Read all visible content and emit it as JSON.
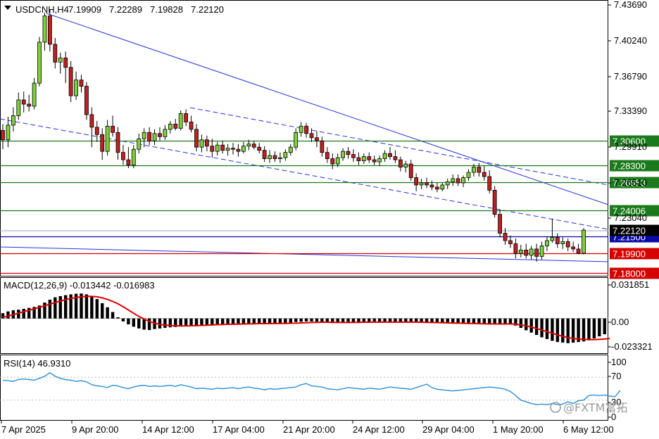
{
  "chart_data": {
    "type": "candlestick",
    "symbol": "USDCNH,H4",
    "ohlc": {
      "open": "7.19909",
      "high": "7.22289",
      "low": "7.19828",
      "close": "7.22120"
    },
    "price_axis": {
      "ylim": [
        7.1775,
        7.4395
      ],
      "ticks": [
        "7.43690",
        "7.40240",
        "7.36790",
        "7.33390",
        "7.29910",
        "7.26510",
        "7.23040"
      ]
    },
    "date_labels": [
      "7 Apr 2025",
      "9 Apr 20:00",
      "14 Apr 12:00",
      "17 Apr 04:00",
      "21 Apr 20:00",
      "24 Apr 12:00",
      "29 Apr 04:00",
      "1 May 20:00",
      "6 May 12:00"
    ],
    "candles": [
      {
        "o": 7.316,
        "h": 7.322,
        "l": 7.298,
        "c": 7.307
      },
      {
        "o": 7.307,
        "h": 7.329,
        "l": 7.3,
        "c": 7.321
      },
      {
        "o": 7.321,
        "h": 7.338,
        "l": 7.315,
        "c": 7.33
      },
      {
        "o": 7.33,
        "h": 7.352,
        "l": 7.326,
        "c": 7.345
      },
      {
        "o": 7.345,
        "h": 7.353,
        "l": 7.333,
        "c": 7.341
      },
      {
        "o": 7.341,
        "h": 7.35,
        "l": 7.334,
        "c": 7.339
      },
      {
        "o": 7.339,
        "h": 7.366,
        "l": 7.336,
        "c": 7.361
      },
      {
        "o": 7.361,
        "h": 7.405,
        "l": 7.358,
        "c": 7.4
      },
      {
        "o": 7.4,
        "h": 7.428,
        "l": 7.392,
        "c": 7.425
      },
      {
        "o": 7.425,
        "h": 7.431,
        "l": 7.391,
        "c": 7.398
      },
      {
        "o": 7.398,
        "h": 7.404,
        "l": 7.375,
        "c": 7.381
      },
      {
        "o": 7.381,
        "h": 7.39,
        "l": 7.37,
        "c": 7.385
      },
      {
        "o": 7.385,
        "h": 7.391,
        "l": 7.361,
        "c": 7.376
      },
      {
        "o": 7.376,
        "h": 7.382,
        "l": 7.343,
        "c": 7.349
      },
      {
        "o": 7.349,
        "h": 7.372,
        "l": 7.345,
        "c": 7.364
      },
      {
        "o": 7.364,
        "h": 7.369,
        "l": 7.352,
        "c": 7.358
      },
      {
        "o": 7.358,
        "h": 7.362,
        "l": 7.326,
        "c": 7.331
      },
      {
        "o": 7.331,
        "h": 7.338,
        "l": 7.3,
        "c": 7.319
      },
      {
        "o": 7.319,
        "h": 7.325,
        "l": 7.305,
        "c": 7.312
      },
      {
        "o": 7.312,
        "h": 7.318,
        "l": 7.288,
        "c": 7.296
      },
      {
        "o": 7.296,
        "h": 7.326,
        "l": 7.292,
        "c": 7.32
      },
      {
        "o": 7.32,
        "h": 7.33,
        "l": 7.31,
        "c": 7.314
      },
      {
        "o": 7.314,
        "h": 7.319,
        "l": 7.288,
        "c": 7.295
      },
      {
        "o": 7.295,
        "h": 7.302,
        "l": 7.283,
        "c": 7.288
      },
      {
        "o": 7.288,
        "h": 7.3,
        "l": 7.28,
        "c": 7.283
      },
      {
        "o": 7.283,
        "h": 7.302,
        "l": 7.28,
        "c": 7.298
      },
      {
        "o": 7.298,
        "h": 7.313,
        "l": 7.294,
        "c": 7.308
      },
      {
        "o": 7.308,
        "h": 7.318,
        "l": 7.3,
        "c": 7.314
      },
      {
        "o": 7.314,
        "h": 7.319,
        "l": 7.302,
        "c": 7.306
      },
      {
        "o": 7.306,
        "h": 7.317,
        "l": 7.302,
        "c": 7.313
      },
      {
        "o": 7.313,
        "h": 7.319,
        "l": 7.306,
        "c": 7.31
      },
      {
        "o": 7.31,
        "h": 7.321,
        "l": 7.307,
        "c": 7.317
      },
      {
        "o": 7.317,
        "h": 7.325,
        "l": 7.313,
        "c": 7.322
      },
      {
        "o": 7.322,
        "h": 7.327,
        "l": 7.316,
        "c": 7.318
      },
      {
        "o": 7.318,
        "h": 7.335,
        "l": 7.316,
        "c": 7.332
      },
      {
        "o": 7.332,
        "h": 7.336,
        "l": 7.32,
        "c": 7.324
      },
      {
        "o": 7.324,
        "h": 7.33,
        "l": 7.314,
        "c": 7.317
      },
      {
        "o": 7.317,
        "h": 7.322,
        "l": 7.296,
        "c": 7.3
      },
      {
        "o": 7.3,
        "h": 7.312,
        "l": 7.295,
        "c": 7.307
      },
      {
        "o": 7.307,
        "h": 7.311,
        "l": 7.296,
        "c": 7.301
      },
      {
        "o": 7.301,
        "h": 7.308,
        "l": 7.29,
        "c": 7.296
      },
      {
        "o": 7.296,
        "h": 7.305,
        "l": 7.292,
        "c": 7.302
      },
      {
        "o": 7.302,
        "h": 7.306,
        "l": 7.294,
        "c": 7.297
      },
      {
        "o": 7.297,
        "h": 7.303,
        "l": 7.292,
        "c": 7.299
      },
      {
        "o": 7.299,
        "h": 7.304,
        "l": 7.293,
        "c": 7.298
      },
      {
        "o": 7.298,
        "h": 7.303,
        "l": 7.291,
        "c": 7.296
      },
      {
        "o": 7.296,
        "h": 7.305,
        "l": 7.294,
        "c": 7.301
      },
      {
        "o": 7.301,
        "h": 7.307,
        "l": 7.297,
        "c": 7.303
      },
      {
        "o": 7.303,
        "h": 7.306,
        "l": 7.298,
        "c": 7.3
      },
      {
        "o": 7.3,
        "h": 7.304,
        "l": 7.294,
        "c": 7.297
      },
      {
        "o": 7.297,
        "h": 7.301,
        "l": 7.286,
        "c": 7.289
      },
      {
        "o": 7.289,
        "h": 7.297,
        "l": 7.285,
        "c": 7.292
      },
      {
        "o": 7.292,
        "h": 7.296,
        "l": 7.286,
        "c": 7.289
      },
      {
        "o": 7.289,
        "h": 7.295,
        "l": 7.285,
        "c": 7.29
      },
      {
        "o": 7.29,
        "h": 7.298,
        "l": 7.287,
        "c": 7.295
      },
      {
        "o": 7.295,
        "h": 7.303,
        "l": 7.292,
        "c": 7.3
      },
      {
        "o": 7.3,
        "h": 7.318,
        "l": 7.297,
        "c": 7.314
      },
      {
        "o": 7.314,
        "h": 7.324,
        "l": 7.31,
        "c": 7.32
      },
      {
        "o": 7.32,
        "h": 7.323,
        "l": 7.309,
        "c": 7.313
      },
      {
        "o": 7.313,
        "h": 7.318,
        "l": 7.305,
        "c": 7.309
      },
      {
        "o": 7.309,
        "h": 7.315,
        "l": 7.3,
        "c": 7.306
      },
      {
        "o": 7.306,
        "h": 7.31,
        "l": 7.291,
        "c": 7.295
      },
      {
        "o": 7.295,
        "h": 7.3,
        "l": 7.285,
        "c": 7.289
      },
      {
        "o": 7.289,
        "h": 7.294,
        "l": 7.279,
        "c": 7.284
      },
      {
        "o": 7.284,
        "h": 7.294,
        "l": 7.281,
        "c": 7.29
      },
      {
        "o": 7.29,
        "h": 7.299,
        "l": 7.287,
        "c": 7.296
      },
      {
        "o": 7.296,
        "h": 7.3,
        "l": 7.289,
        "c": 7.293
      },
      {
        "o": 7.293,
        "h": 7.298,
        "l": 7.286,
        "c": 7.29
      },
      {
        "o": 7.29,
        "h": 7.295,
        "l": 7.283,
        "c": 7.287
      },
      {
        "o": 7.287,
        "h": 7.294,
        "l": 7.284,
        "c": 7.291
      },
      {
        "o": 7.291,
        "h": 7.295,
        "l": 7.285,
        "c": 7.288
      },
      {
        "o": 7.288,
        "h": 7.292,
        "l": 7.283,
        "c": 7.286
      },
      {
        "o": 7.286,
        "h": 7.292,
        "l": 7.282,
        "c": 7.289
      },
      {
        "o": 7.289,
        "h": 7.297,
        "l": 7.286,
        "c": 7.294
      },
      {
        "o": 7.294,
        "h": 7.3,
        "l": 7.288,
        "c": 7.291
      },
      {
        "o": 7.291,
        "h": 7.297,
        "l": 7.285,
        "c": 7.288
      },
      {
        "o": 7.288,
        "h": 7.291,
        "l": 7.277,
        "c": 7.281
      },
      {
        "o": 7.281,
        "h": 7.287,
        "l": 7.276,
        "c": 7.284
      },
      {
        "o": 7.284,
        "h": 7.288,
        "l": 7.268,
        "c": 7.271
      },
      {
        "o": 7.271,
        "h": 7.275,
        "l": 7.258,
        "c": 7.264
      },
      {
        "o": 7.264,
        "h": 7.27,
        "l": 7.26,
        "c": 7.266
      },
      {
        "o": 7.266,
        "h": 7.271,
        "l": 7.261,
        "c": 7.264
      },
      {
        "o": 7.264,
        "h": 7.268,
        "l": 7.259,
        "c": 7.262
      },
      {
        "o": 7.262,
        "h": 7.266,
        "l": 7.257,
        "c": 7.26
      },
      {
        "o": 7.26,
        "h": 7.266,
        "l": 7.258,
        "c": 7.264
      },
      {
        "o": 7.264,
        "h": 7.27,
        "l": 7.26,
        "c": 7.267
      },
      {
        "o": 7.267,
        "h": 7.274,
        "l": 7.263,
        "c": 7.27
      },
      {
        "o": 7.27,
        "h": 7.274,
        "l": 7.263,
        "c": 7.266
      },
      {
        "o": 7.266,
        "h": 7.273,
        "l": 7.262,
        "c": 7.271
      },
      {
        "o": 7.271,
        "h": 7.279,
        "l": 7.268,
        "c": 7.276
      },
      {
        "o": 7.276,
        "h": 7.284,
        "l": 7.272,
        "c": 7.281
      },
      {
        "o": 7.281,
        "h": 7.285,
        "l": 7.272,
        "c": 7.276
      },
      {
        "o": 7.276,
        "h": 7.282,
        "l": 7.268,
        "c": 7.272
      },
      {
        "o": 7.272,
        "h": 7.278,
        "l": 7.256,
        "c": 7.259
      },
      {
        "o": 7.259,
        "h": 7.263,
        "l": 7.233,
        "c": 7.236
      },
      {
        "o": 7.236,
        "h": 7.241,
        "l": 7.214,
        "c": 7.218
      },
      {
        "o": 7.218,
        "h": 7.223,
        "l": 7.207,
        "c": 7.211
      },
      {
        "o": 7.211,
        "h": 7.216,
        "l": 7.204,
        "c": 7.208
      },
      {
        "o": 7.208,
        "h": 7.213,
        "l": 7.194,
        "c": 7.199
      },
      {
        "o": 7.199,
        "h": 7.207,
        "l": 7.195,
        "c": 7.202
      },
      {
        "o": 7.202,
        "h": 7.208,
        "l": 7.194,
        "c": 7.197
      },
      {
        "o": 7.197,
        "h": 7.206,
        "l": 7.193,
        "c": 7.203
      },
      {
        "o": 7.203,
        "h": 7.208,
        "l": 7.191,
        "c": 7.196
      },
      {
        "o": 7.196,
        "h": 7.21,
        "l": 7.193,
        "c": 7.206
      },
      {
        "o": 7.206,
        "h": 7.215,
        "l": 7.201,
        "c": 7.211
      },
      {
        "o": 7.211,
        "h": 7.232,
        "l": 7.209,
        "c": 7.214
      },
      {
        "o": 7.214,
        "h": 7.218,
        "l": 7.204,
        "c": 7.208
      },
      {
        "o": 7.208,
        "h": 7.214,
        "l": 7.203,
        "c": 7.21
      },
      {
        "o": 7.21,
        "h": 7.213,
        "l": 7.201,
        "c": 7.205
      },
      {
        "o": 7.205,
        "h": 7.21,
        "l": 7.2,
        "c": 7.203
      },
      {
        "o": 7.203,
        "h": 7.208,
        "l": 7.198,
        "c": 7.199
      },
      {
        "o": 7.199,
        "h": 7.223,
        "l": 7.198,
        "c": 7.221
      }
    ],
    "horizontal_lines": [
      {
        "label": "7.30600",
        "value": 7.306,
        "color": "#1b7a1b"
      },
      {
        "label": "7.28300",
        "value": 7.283,
        "color": "#1b7a1b"
      },
      {
        "label": "7.26653",
        "value": 7.26653,
        "color": "#1b7a1b"
      },
      {
        "label": "7.24006",
        "value": 7.24006,
        "color": "#1b7a1b"
      },
      {
        "label": "7.21500",
        "value": 7.215,
        "color": "#0a0aa8"
      },
      {
        "label": "7.19900",
        "value": 7.199,
        "color": "#d50000"
      },
      {
        "label": "7.18000",
        "value": 7.18,
        "color": "#d50000"
      }
    ],
    "current_price": {
      "label": "7.22120",
      "value": 7.2212
    },
    "macd": {
      "label": "MACD(12,26,9) -0.013442 -0.016983",
      "ylim": [
        -0.0295,
        0.0345
      ],
      "ticks": [
        "0.031851",
        "0.00",
        "-0.023321"
      ],
      "histogram": [
        0.0045,
        0.006,
        0.007,
        0.0075,
        0.0082,
        0.009,
        0.0098,
        0.011,
        0.0135,
        0.016,
        0.018,
        0.019,
        0.0198,
        0.0205,
        0.021,
        0.0212,
        0.0205,
        0.019,
        0.0165,
        0.013,
        0.0095,
        0.0055,
        0.001,
        -0.0025,
        -0.005,
        -0.007,
        -0.0085,
        -0.0095,
        -0.0098,
        -0.009,
        -0.0085,
        -0.008,
        -0.0075,
        -0.0072,
        -0.0068,
        -0.0065,
        -0.006,
        -0.0058,
        -0.0055,
        -0.0052,
        -0.005,
        -0.0048,
        -0.0047,
        -0.0046,
        -0.0045,
        -0.0045,
        -0.0044,
        -0.0044,
        -0.0043,
        -0.0043,
        -0.0042,
        -0.0042,
        -0.0041,
        -0.004,
        -0.0038,
        -0.0035,
        -0.003,
        -0.0028,
        -0.0025,
        -0.0025,
        -0.0027,
        -0.003,
        -0.0032,
        -0.0034,
        -0.0035,
        -0.0034,
        -0.0033,
        -0.0032,
        -0.0031,
        -0.003,
        -0.003,
        -0.0029,
        -0.0029,
        -0.003,
        -0.003,
        -0.0031,
        -0.0031,
        -0.003,
        -0.0031,
        -0.0032,
        -0.0034,
        -0.0036,
        -0.0038,
        -0.004,
        -0.0041,
        -0.0042,
        -0.0043,
        -0.0044,
        -0.0045,
        -0.0046,
        -0.0047,
        -0.0049,
        -0.005,
        -0.0051,
        -0.005,
        -0.0048,
        -0.0045,
        -0.0045,
        -0.006,
        -0.008,
        -0.01,
        -0.012,
        -0.014,
        -0.016,
        -0.0175,
        -0.019,
        -0.02,
        -0.0205,
        -0.021,
        -0.0205,
        -0.02,
        -0.0195,
        -0.0185,
        -0.017,
        -0.0152,
        -0.0134
      ],
      "signal": [
        0.001,
        0.002,
        0.0032,
        0.0045,
        0.0058,
        0.007,
        0.0082,
        0.0095,
        0.0108,
        0.0122,
        0.0136,
        0.0148,
        0.016,
        0.017,
        0.0178,
        0.0184,
        0.0188,
        0.0188,
        0.0184,
        0.0175,
        0.0162,
        0.0145,
        0.0125,
        0.01,
        0.0072,
        0.0044,
        0.0018,
        -0.0005,
        -0.0025,
        -0.004,
        -0.005,
        -0.0056,
        -0.006,
        -0.0062,
        -0.0063,
        -0.0063,
        -0.0062,
        -0.0061,
        -0.0059,
        -0.0057,
        -0.0055,
        -0.0053,
        -0.0051,
        -0.005,
        -0.0049,
        -0.0048,
        -0.0047,
        -0.0046,
        -0.0045,
        -0.0044,
        -0.0044,
        -0.0043,
        -0.0043,
        -0.0042,
        -0.0042,
        -0.0041,
        -0.004,
        -0.0038,
        -0.0036,
        -0.0034,
        -0.0033,
        -0.0032,
        -0.0032,
        -0.0033,
        -0.0034,
        -0.0034,
        -0.0034,
        -0.0033,
        -0.0033,
        -0.0032,
        -0.0032,
        -0.0031,
        -0.0031,
        -0.0031,
        -0.0031,
        -0.0031,
        -0.0031,
        -0.0031,
        -0.0031,
        -0.0031,
        -0.0032,
        -0.0033,
        -0.0034,
        -0.0035,
        -0.0036,
        -0.0037,
        -0.0039,
        -0.004,
        -0.0041,
        -0.0042,
        -0.0043,
        -0.0044,
        -0.0045,
        -0.0046,
        -0.0047,
        -0.0047,
        -0.0047,
        -0.0046,
        -0.0049,
        -0.0055,
        -0.0063,
        -0.0073,
        -0.0085,
        -0.0098,
        -0.0112,
        -0.0126,
        -0.014,
        -0.0152,
        -0.0162,
        -0.017,
        -0.0175,
        -0.0178,
        -0.018,
        -0.018,
        -0.0178,
        -0.0175,
        -0.017
      ]
    },
    "rsi": {
      "label": "RSI(14) 46.9310",
      "ylim": [
        0,
        100
      ],
      "ticks": [
        "100",
        "70",
        "30",
        "0"
      ],
      "levels": [
        70,
        30
      ],
      "values": [
        65,
        64,
        63,
        66,
        67,
        66,
        65,
        68,
        72,
        78,
        72,
        68,
        66,
        65,
        63,
        64,
        62,
        57,
        55,
        54,
        52,
        56,
        55,
        52,
        50,
        53,
        55,
        56,
        54,
        55,
        54,
        55,
        56,
        54,
        57,
        55,
        53,
        50,
        51,
        50,
        49,
        51,
        50,
        51,
        52,
        50,
        52,
        53,
        51,
        50,
        48,
        50,
        49,
        50,
        51,
        52,
        53,
        57,
        59,
        55,
        54,
        53,
        50,
        49,
        48,
        50,
        52,
        51,
        50,
        49,
        51,
        50,
        49,
        51,
        53,
        52,
        51,
        50,
        49,
        52,
        55,
        58,
        52,
        49,
        48,
        47,
        46,
        47,
        48,
        49,
        50,
        51,
        52,
        53,
        52,
        51,
        49,
        45,
        38,
        30,
        27,
        24,
        22,
        23,
        22,
        24,
        22,
        23,
        27,
        24,
        29,
        30,
        38,
        39,
        38,
        39,
        37,
        36,
        47
      ]
    }
  },
  "watermark": {
    "logo_text": "@FXTM富拓"
  }
}
